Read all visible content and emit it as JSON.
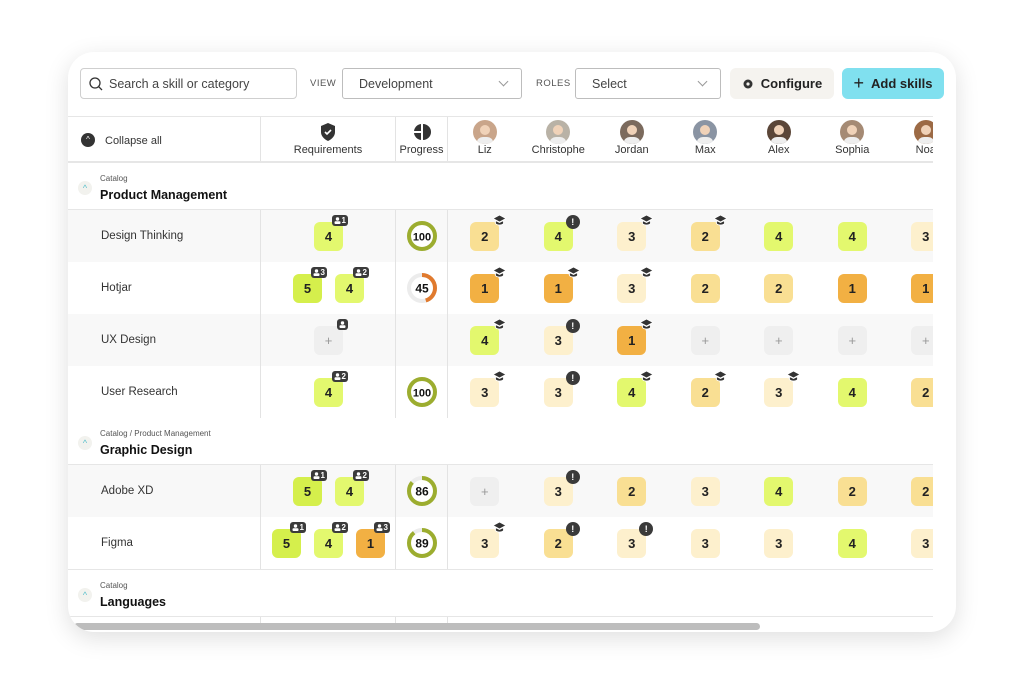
{
  "toolbar": {
    "search_placeholder": "Search a skill or category",
    "view_label": "VIEW",
    "view_value": "Development",
    "roles_label": "ROLES",
    "roles_value": "Select",
    "configure_label": "Configure",
    "add_label": "Add skills"
  },
  "colors": {
    "level5": "#d5ef4c",
    "level4": "#e3f86e",
    "level3": "#fdf0cd",
    "level2": "#f9df93",
    "level1": "#f2b043",
    "empty": "#efefef",
    "accent": "#80e0ef",
    "progress_full": "#9cad2f",
    "progress_low": "#e07a2e"
  },
  "header": {
    "collapse_label": "Collapse all",
    "requirements_label": "Requirements",
    "progress_label": "Progress",
    "people": [
      {
        "name": "Liz",
        "color": "#c9a58a"
      },
      {
        "name": "Christophe",
        "color": "#b9b2a6"
      },
      {
        "name": "Jordan",
        "color": "#7b6a5d"
      },
      {
        "name": "Max",
        "color": "#8a94a3"
      },
      {
        "name": "Alex",
        "color": "#5b4638"
      },
      {
        "name": "Sophia",
        "color": "#a58a74"
      },
      {
        "name": "Noa",
        "color": "#9c6a45"
      }
    ]
  },
  "groups": [
    {
      "path": "Catalog",
      "title": "Product Management",
      "rows": [
        {
          "name": "Design Thinking",
          "req": [
            {
              "v": "4",
              "n": "1"
            }
          ],
          "progress": 100,
          "cells": [
            {
              "v": "2",
              "b": "cap"
            },
            {
              "v": "4",
              "b": "alert"
            },
            {
              "v": "3",
              "b": "cap"
            },
            {
              "v": "2",
              "b": "cap"
            },
            {
              "v": "4"
            },
            {
              "v": "4"
            },
            {
              "v": "3"
            }
          ]
        },
        {
          "name": "Hotjar",
          "req": [
            {
              "v": "5",
              "n": "3"
            },
            {
              "v": "4",
              "n": "2"
            }
          ],
          "progress": 45,
          "cells": [
            {
              "v": "1",
              "b": "cap"
            },
            {
              "v": "1",
              "b": "cap"
            },
            {
              "v": "3",
              "b": "cap"
            },
            {
              "v": "2"
            },
            {
              "v": "2"
            },
            {
              "v": "1"
            },
            {
              "v": "1"
            }
          ]
        },
        {
          "name": "UX Design",
          "req": [
            {
              "v": "+",
              "n": ""
            }
          ],
          "progress": null,
          "cells": [
            {
              "v": "4",
              "b": "cap"
            },
            {
              "v": "3",
              "b": "alert"
            },
            {
              "v": "1",
              "b": "cap"
            },
            {
              "v": "+"
            },
            {
              "v": "+"
            },
            {
              "v": "+"
            },
            {
              "v": "+"
            }
          ]
        },
        {
          "name": "User Research",
          "req": [
            {
              "v": "4",
              "n": "2"
            }
          ],
          "progress": 100,
          "cells": [
            {
              "v": "3",
              "b": "cap"
            },
            {
              "v": "3",
              "b": "alert"
            },
            {
              "v": "4",
              "b": "cap"
            },
            {
              "v": "2",
              "b": "cap"
            },
            {
              "v": "3",
              "b": "cap"
            },
            {
              "v": "4"
            },
            {
              "v": "2"
            }
          ]
        }
      ]
    },
    {
      "path": "Catalog / Product Management",
      "title": "Graphic Design",
      "rows": [
        {
          "name": "Adobe XD",
          "req": [
            {
              "v": "5",
              "n": "1"
            },
            {
              "v": "4",
              "n": "2"
            }
          ],
          "progress": 86,
          "cells": [
            {
              "v": "+"
            },
            {
              "v": "3",
              "b": "alert"
            },
            {
              "v": "2"
            },
            {
              "v": "3"
            },
            {
              "v": "4"
            },
            {
              "v": "2"
            },
            {
              "v": "2"
            }
          ]
        },
        {
          "name": "Figma",
          "req": [
            {
              "v": "5",
              "n": "1"
            },
            {
              "v": "4",
              "n": "2"
            },
            {
              "v": "1",
              "n": "3"
            }
          ],
          "progress": 89,
          "cells": [
            {
              "v": "3",
              "b": "cap"
            },
            {
              "v": "2",
              "b": "alert"
            },
            {
              "v": "3",
              "b": "alert"
            },
            {
              "v": "3"
            },
            {
              "v": "3"
            },
            {
              "v": "4"
            },
            {
              "v": "3"
            }
          ]
        }
      ]
    },
    {
      "path": "Catalog",
      "title": "Languages",
      "rows": []
    }
  ]
}
